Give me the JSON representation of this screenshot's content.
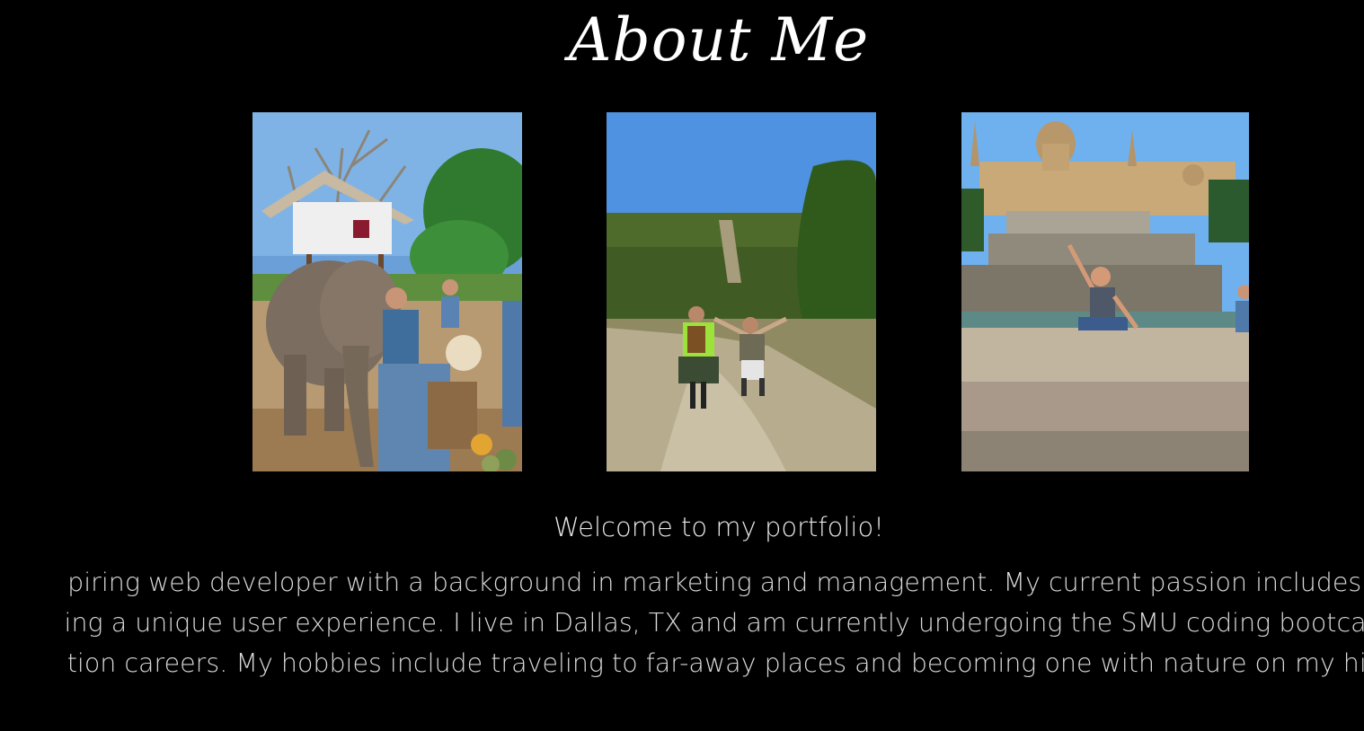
{
  "header": {
    "title": "About Me"
  },
  "photos": [
    {
      "name": "elephant-photo",
      "description_icon": "elephant-scene"
    },
    {
      "name": "hiking-photo",
      "description_icon": "trail-scene"
    },
    {
      "name": "fountain-photo",
      "description_icon": "palace-fountain-scene"
    }
  ],
  "intro": {
    "welcome": "Welcome to my portfolio!",
    "lines": [
      "piring web developer with a background in marketing and management. My current passion includes fro",
      "ing a unique user experience. I live in Dallas, TX and am currently undergoing the SMU coding bootcamp",
      "tion careers. My hobbies include traveling to far-away places and becoming one with nature on my hikin"
    ]
  },
  "colors": {
    "background": "#000000",
    "text": "#e6e6e6"
  }
}
